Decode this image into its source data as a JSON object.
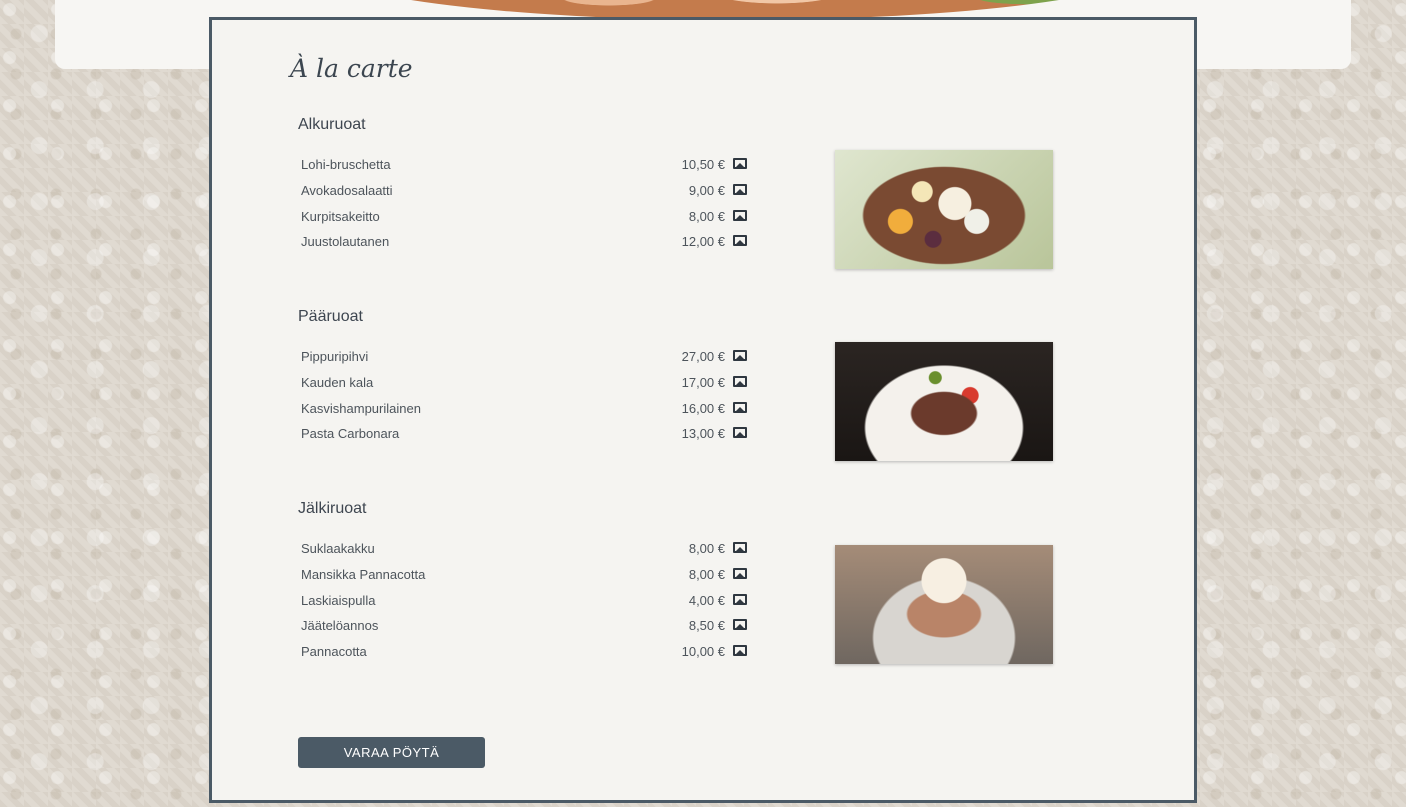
{
  "menu": {
    "title": "À la carte",
    "reserve_button": "VARAA PÖYTÄ",
    "sections": [
      {
        "heading": "Alkuruoat",
        "items": [
          {
            "name": "Lohi-bruschetta",
            "price": "10,50 €"
          },
          {
            "name": "Avokadosalaatti",
            "price": "9,00 €"
          },
          {
            "name": "Kurpitsakeitto",
            "price": "8,00 €"
          },
          {
            "name": "Juustolautanen",
            "price": "12,00 €"
          }
        ]
      },
      {
        "heading": "Pääruoat",
        "items": [
          {
            "name": "Pippuripihvi",
            "price": "27,00 €"
          },
          {
            "name": "Kauden kala",
            "price": "17,00 €"
          },
          {
            "name": "Kasvishampurilainen",
            "price": "16,00 €"
          },
          {
            "name": "Pasta Carbonara",
            "price": "13,00 €"
          }
        ]
      },
      {
        "heading": "Jälkiruoat",
        "items": [
          {
            "name": "Suklaakakku",
            "price": "8,00 €"
          },
          {
            "name": "Mansikka Pannacotta",
            "price": "8,00 €"
          },
          {
            "name": "Laskiaispulla",
            "price": "4,00 €"
          },
          {
            "name": "Jäätelöannos",
            "price": "8,50 €"
          },
          {
            "name": "Pannacotta",
            "price": "10,00 €"
          }
        ]
      }
    ]
  },
  "icons": {
    "item_image": "image-icon"
  },
  "colors": {
    "accent": "#4b5a66",
    "card_background": "#f5f4f1",
    "page_background": "#ddd6cc"
  }
}
